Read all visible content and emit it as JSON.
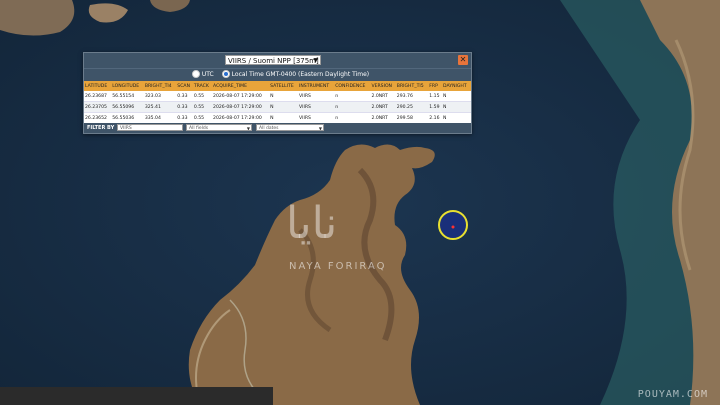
{
  "map": {
    "water_color": "#1a2f46",
    "land_color": "#8a6a47",
    "fire_marker_color": "#e8e030"
  },
  "panel": {
    "layer_select": "VIIRS / Suomi NPP [375m]",
    "close_label": "✕",
    "timezone": {
      "utc_label": "UTC",
      "local_label": "Local Time GMT-0400 (Eastern Daylight Time)"
    },
    "columns": [
      "LATITUDE",
      "LONGITUDE",
      "BRIGHT_TI4",
      "SCAN",
      "TRACK",
      "ACQUIRE_TIME",
      "SATELLITE",
      "INSTRUMENT",
      "CONFIDENCE",
      "VERSION",
      "BRIGHT_TI5",
      "FRP",
      "DAYNIGHT"
    ],
    "rows": [
      [
        "26.23687",
        "56.55154",
        "323.03",
        "0.33",
        "0.55",
        "2026-08-07 17:29:00",
        "N",
        "VIIRS",
        "n",
        "2.0NRT",
        "293.76",
        "1.15",
        "N"
      ],
      [
        "26.23705",
        "56.55096",
        "325.41",
        "0.33",
        "0.55",
        "2026-08-07 17:29:00",
        "N",
        "VIIRS",
        "n",
        "2.0NRT",
        "290.25",
        "1.59",
        "N"
      ],
      [
        "26.23652",
        "56.55036",
        "335.04",
        "0.33",
        "0.55",
        "2026-08-07 17:29:00",
        "N",
        "VIIRS",
        "n",
        "2.0NRT",
        "299.58",
        "2.16",
        "N"
      ]
    ],
    "filter": {
      "label": "FILTER BY",
      "input_placeholder": "VIIRS",
      "select_1": "All fields",
      "select_2": "All dates"
    }
  },
  "watermark": {
    "arabic": "نایا",
    "text": "NAYA FORIRAQ"
  },
  "corner_mark": "POUYAM.COM"
}
